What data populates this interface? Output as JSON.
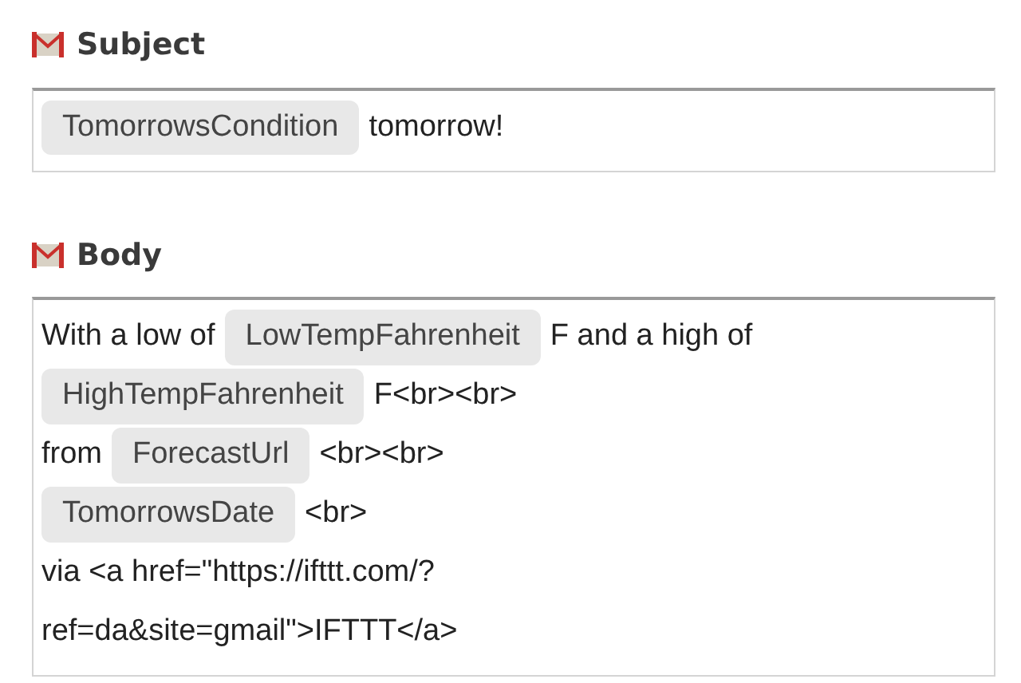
{
  "fields": [
    {
      "label": "Subject",
      "lines": [
        [
          {
            "kind": "ingredient",
            "text": "TomorrowsCondition"
          },
          {
            "kind": "text",
            "text": "tomorrow!"
          }
        ]
      ]
    },
    {
      "label": "Body",
      "lines": [
        [
          {
            "kind": "text",
            "text": "With a low of"
          },
          {
            "kind": "ingredient",
            "text": "LowTempFahrenheit"
          },
          {
            "kind": "text",
            "text": "F and a high of"
          }
        ],
        [
          {
            "kind": "ingredient",
            "text": "HighTempFahrenheit"
          },
          {
            "kind": "text",
            "text": "F<br><br>"
          }
        ],
        [
          {
            "kind": "text",
            "text": "from"
          },
          {
            "kind": "ingredient",
            "text": "ForecastUrl"
          },
          {
            "kind": "text",
            "text": "<br><br>"
          }
        ],
        [
          {
            "kind": "ingredient",
            "text": "TomorrowsDate"
          },
          {
            "kind": "text",
            "text": "<br>"
          }
        ],
        [
          {
            "kind": "text",
            "text": "via <a href=\"https://ifttt.com/?"
          }
        ],
        [
          {
            "kind": "text",
            "text": "ref=da&site=gmail\">IFTTT</a>"
          }
        ]
      ]
    }
  ]
}
